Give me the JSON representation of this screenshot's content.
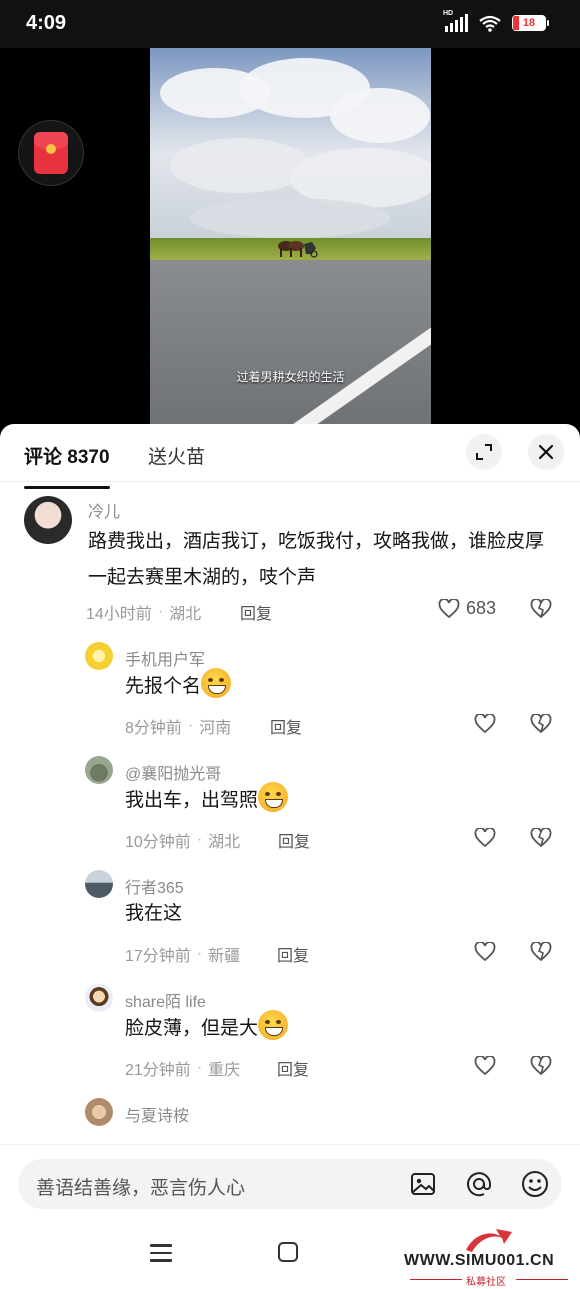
{
  "status_bar": {
    "time": "4:09",
    "network": "HD",
    "battery": "18"
  },
  "video": {
    "caption": "过着男耕女织的生活"
  },
  "sheet": {
    "tabs": [
      {
        "label": "评论 8370"
      },
      {
        "label": "送火苗"
      }
    ]
  },
  "comments": [
    {
      "user": "冷儿",
      "text": "路费我出，酒店我订，吃饭我付，攻略我做，谁脸皮厚一起去赛里木湖的，吱个声",
      "time": "14小时前",
      "location": "湖北",
      "reply_label": "回复",
      "likes": "683"
    }
  ],
  "replies": [
    {
      "user": "手机用户军",
      "text": "先报个名",
      "emoji": "laugh-cry",
      "time": "8分钟前",
      "location": "河南",
      "reply_label": "回复"
    },
    {
      "user": "@襄阳抛光哥",
      "text": "我出车，出驾照",
      "emoji": "wink-tongue",
      "time": "10分钟前",
      "location": "湖北",
      "reply_label": "回复"
    },
    {
      "user": "行者365",
      "text": "我在这",
      "emoji": "",
      "time": "17分钟前",
      "location": "新疆",
      "reply_label": "回复"
    },
    {
      "user": "share陌 life",
      "text": "脸皮薄，但是大",
      "emoji": "grin",
      "time": "21分钟前",
      "location": "重庆",
      "reply_label": "回复"
    },
    {
      "user": "与夏诗桉"
    }
  ],
  "input": {
    "placeholder": "善语结善缘，恶言伤人心"
  },
  "watermark": {
    "text": "WWW.SIMU001.CN",
    "sub": "私募社区"
  },
  "icons": {
    "expand": "expand-icon",
    "close": "close-icon",
    "like": "heart-outline-icon",
    "dislike": "broken-heart-icon",
    "image": "image-icon",
    "mention": "at-icon",
    "emoji": "smiley-icon"
  },
  "colors": {
    "accent_red": "#e8323f",
    "watermark_red": "#c0242c"
  }
}
